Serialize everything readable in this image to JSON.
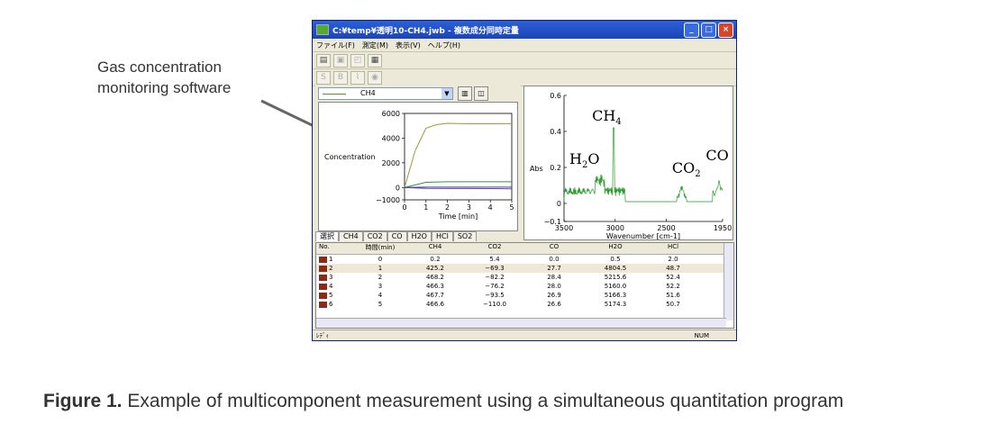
{
  "annotation": {
    "line1": "Gas concentration",
    "line2": "monitoring software"
  },
  "caption": {
    "bold": "Figure 1.",
    "text": " Example of multicomponent measurement using a simultaneous quantitation program"
  },
  "window": {
    "title": "C:¥temp¥透明10-CH4.jwb - 複数成分同時定量",
    "menu": [
      "ファイル(F)",
      "測定(M)",
      "表示(V)",
      "ヘルプ(H)"
    ],
    "series_selected": "CH4",
    "tabs": [
      "選択",
      "CH4",
      "CO2",
      "CO",
      "H2O",
      "HCl",
      "SO2"
    ],
    "status_left": "ﾚﾃﾞｨ",
    "status_right": "NUM"
  },
  "table": {
    "headers": [
      "No.",
      "時間(min)",
      "CH4",
      "CO2",
      "CO",
      "H2O",
      "HCl"
    ],
    "rows": [
      [
        "1",
        "0",
        "0.2",
        "5.4",
        "0.0",
        "0.5",
        "2.0"
      ],
      [
        "2",
        "1",
        "425.2",
        "−69.3",
        "27.7",
        "4804.5",
        "48.7"
      ],
      [
        "3",
        "2",
        "468.2",
        "−82.2",
        "28.4",
        "5215.6",
        "52.4"
      ],
      [
        "4",
        "3",
        "466.3",
        "−76.2",
        "28.0",
        "5160.0",
        "52.2"
      ],
      [
        "5",
        "4",
        "467.7",
        "−93.5",
        "26.9",
        "5166.3",
        "51.6"
      ],
      [
        "6",
        "5",
        "466.6",
        "−110.0",
        "26.6",
        "5174.3",
        "50.7"
      ]
    ]
  },
  "chart_data": [
    {
      "type": "line",
      "ylabel": "Concentration",
      "xlabel": "Time [min]",
      "xlim": [
        0,
        5
      ],
      "ylim": [
        -1000,
        6000
      ],
      "x_ticks": [
        "0",
        "1",
        "2",
        "3",
        "4",
        "5"
      ],
      "y_ticks": [
        "6000",
        "4000",
        "2000",
        "0",
        "−1000"
      ],
      "series": [
        {
          "x": [
            0,
            0.5,
            1,
            1.5,
            2,
            3,
            4,
            5
          ],
          "values": [
            0,
            3000,
            4800,
            5100,
            5200,
            5160,
            5166,
            5174
          ],
          "color": "#9a9a3a"
        },
        {
          "x": [
            0,
            1,
            2,
            3,
            4,
            5
          ],
          "values": [
            0,
            425,
            468,
            466,
            468,
            467
          ],
          "color": "#3a8f3a"
        },
        {
          "x": [
            0,
            1,
            2,
            3,
            4,
            5
          ],
          "values": [
            5,
            -69,
            -82,
            -76,
            -93,
            -110
          ],
          "color": "#7a3a9a"
        },
        {
          "x": [
            0,
            1,
            2,
            3,
            4,
            5
          ],
          "values": [
            0,
            28,
            28,
            28,
            27,
            27
          ],
          "color": "#2a4ab0"
        }
      ]
    },
    {
      "type": "line",
      "ylabel": "Abs",
      "xlabel": "Wavenumber [cm-1]",
      "xlim": [
        3500,
        1950
      ],
      "ylim": [
        -0.1,
        0.6
      ],
      "x_ticks": [
        "3500",
        "3000",
        "2500",
        "1950"
      ],
      "y_ticks": [
        "0.6",
        "0.4",
        "0.2",
        "0",
        "−0.1"
      ],
      "peak_labels": [
        "H2O",
        "CH4",
        "CO2",
        "CO"
      ],
      "color": "#2a9a2a"
    }
  ]
}
